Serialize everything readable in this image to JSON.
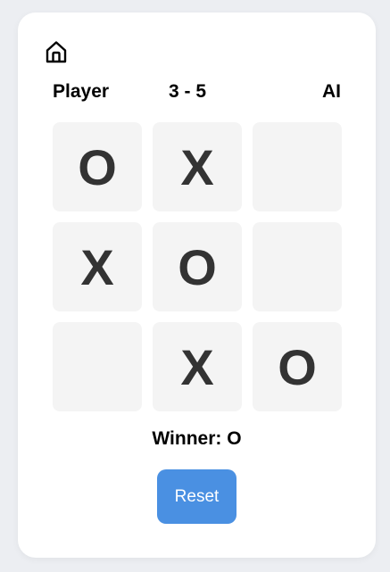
{
  "header": {
    "home_icon": "home-icon",
    "player_label": "Player",
    "score": "3 - 5",
    "ai_label": "AI"
  },
  "board": {
    "cells": [
      "O",
      "X",
      "",
      "X",
      "O",
      "",
      "",
      "X",
      "O"
    ]
  },
  "status": {
    "text": "Winner: O"
  },
  "controls": {
    "reset_label": "Reset"
  },
  "colors": {
    "background": "#eceef2",
    "card": "#ffffff",
    "cell": "#f4f4f4",
    "mark": "#333333",
    "reset_button": "#4a90e2"
  }
}
